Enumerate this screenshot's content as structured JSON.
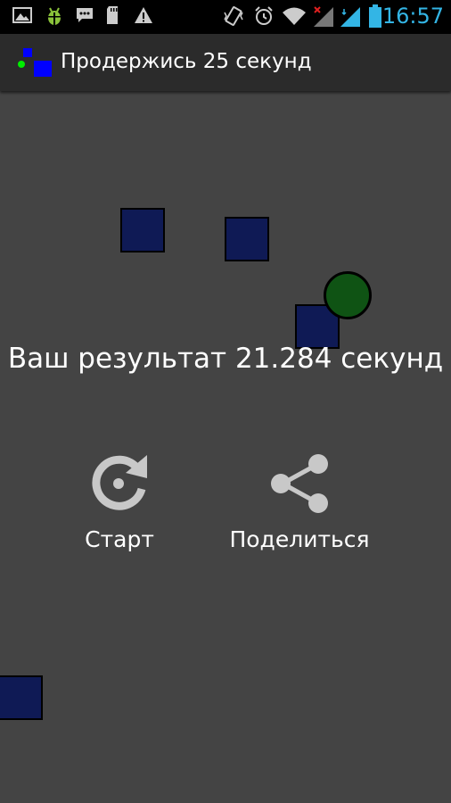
{
  "status_bar": {
    "time": "16:57",
    "accent_color": "#33b5e5",
    "icons": [
      "gallery-icon",
      "android-debug-icon",
      "chat-icon",
      "sd-card-icon",
      "warning-icon",
      "vibrate-icon",
      "alarm-icon",
      "wifi-icon",
      "signal-no-service-icon",
      "signal-icon",
      "battery-icon"
    ]
  },
  "action_bar": {
    "title": "Продержись 25 секунд",
    "icon": "app-logo-icon"
  },
  "game": {
    "result_text": "Ваш результат 21.284 секунд",
    "start_label": "Старт",
    "share_label": "Поделиться",
    "block_color": "#0f1a55",
    "player_color": "#0f5314",
    "background_color": "#444444"
  }
}
